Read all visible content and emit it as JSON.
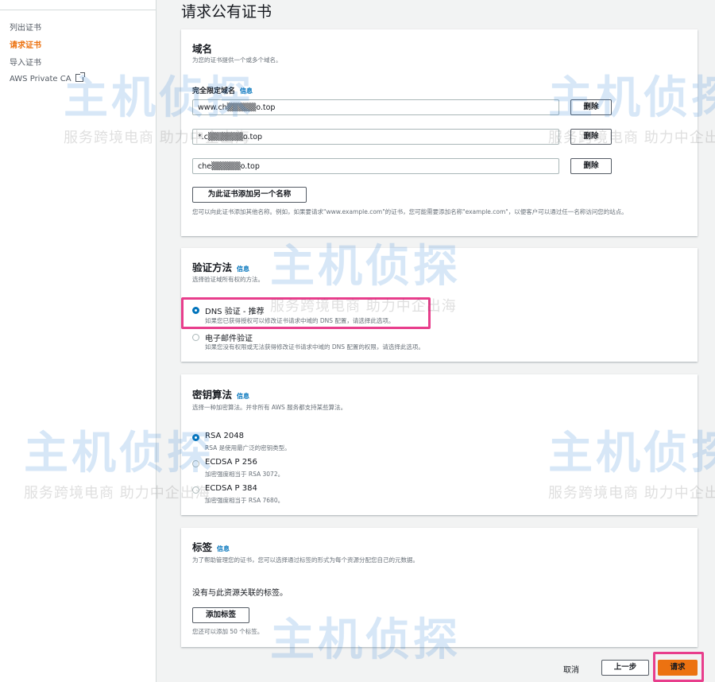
{
  "sidebar": {
    "items": [
      {
        "label": "列出证书"
      },
      {
        "label": "请求证书"
      },
      {
        "label": "导入证书"
      },
      {
        "label": "AWS Private CA"
      }
    ]
  },
  "page_title": "请求公有证书",
  "domain_panel": {
    "title": "域名",
    "description": "为您的证书提供一个或多个域名。",
    "field_label": "完全限定域名",
    "info": "信息",
    "domains": [
      "www.ch▒▒▒▒▒o.top",
      "*.c▒▒▒▒▒▒o.top",
      "che▒▒▒▒▒o.top"
    ],
    "remove_label": "删除",
    "add_button": "为此证书添加另一个名称",
    "hint": "您可以向此证书添加其他名称。例如，如果要请求\"www.example.com\"的证书，您可能需要添加名称\"example.com\"，以便客户可以通过任一名称访问您的站点。"
  },
  "validation_panel": {
    "title": "验证方法",
    "info": "信息",
    "description": "选择验证域所有权的方法。",
    "options": [
      {
        "title": "DNS 验证 - 推荐",
        "desc": "如果您已获得授权可以修改证书请求中域的 DNS 配置，请选择此选项。",
        "selected": true
      },
      {
        "title": "电子邮件验证",
        "desc": "如果您没有权限或无法获得修改证书请求中域的 DNS 配置的权限，请选择此选项。",
        "selected": false
      }
    ]
  },
  "algorithm_panel": {
    "title": "密钥算法",
    "info": "信息",
    "description": "选择一种加密算法。并非所有 AWS 服务都支持某些算法。",
    "options": [
      {
        "title": "RSA 2048",
        "desc": "RSA 是使用最广泛的密钥类型。",
        "selected": true
      },
      {
        "title": "ECDSA P 256",
        "desc": "加密强度相当于 RSA 3072。",
        "selected": false
      },
      {
        "title": "ECDSA P 384",
        "desc": "加密强度相当于 RSA 7680。",
        "selected": false
      }
    ]
  },
  "tags_panel": {
    "title": "标签",
    "info": "信息",
    "description": "为了帮助管理您的证书，您可以选择通过标签的形式为每个资源分配您自己的元数据。",
    "empty_text": "没有与此资源关联的标签。",
    "add_button": "添加标签",
    "limit_text": "您还可以添加 50 个标签。"
  },
  "footer": {
    "cancel": "取消",
    "previous": "上一步",
    "request": "请求"
  },
  "watermark": {
    "brand": "主机侦探",
    "slogan": "服务跨境电商 助力中企出海"
  },
  "colors": {
    "accent": "#ec7211",
    "link": "#0073bb",
    "highlight": "#e83e8c",
    "primary_button": "#ec7211"
  }
}
